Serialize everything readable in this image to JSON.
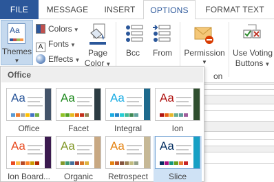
{
  "tabs": [
    {
      "label": "FILE"
    },
    {
      "label": "MESSAGE"
    },
    {
      "label": "INSERT"
    },
    {
      "label": "OPTIONS"
    },
    {
      "label": "FORMAT TEXT"
    }
  ],
  "active_tab": "OPTIONS",
  "ribbon": {
    "themes_label": "Themes",
    "colors_label": "Colors",
    "fonts_label": "Fonts",
    "effects_label": "Effects",
    "page_color_label_1": "Page",
    "page_color_label_2": "Color",
    "bcc_label": "Bcc",
    "from_label": "From",
    "permission_label": "Permission",
    "voting_label_1": "Use Voting",
    "voting_label_2": "Buttons",
    "partial_group_label": "on"
  },
  "themes_menu": {
    "section_header": "Office",
    "selected": "Slice",
    "themes": [
      {
        "name": "Office",
        "accent": "#2b579a",
        "swatches": [
          "#5b9bd5",
          "#ed7d31",
          "#a5a5a5",
          "#ffc000",
          "#4472c4",
          "#70ad47"
        ],
        "sidebar": "#44546a"
      },
      {
        "name": "Facet",
        "accent": "#218b21",
        "swatches": [
          "#90c226",
          "#54a021",
          "#e6b91e",
          "#e76618",
          "#c42f1a",
          "#918655"
        ],
        "sidebar": "#2c3c43"
      },
      {
        "name": "Integral",
        "accent": "#1cade4",
        "swatches": [
          "#1cade4",
          "#2683c6",
          "#27ced7",
          "#42ba97",
          "#3e8853",
          "#62a39f"
        ],
        "sidebar": "#1e6a8d"
      },
      {
        "name": "Ion",
        "accent": "#b01513",
        "swatches": [
          "#b01513",
          "#ea6312",
          "#e6b729",
          "#6aac90",
          "#5f9c9d",
          "#9e5e9b"
        ],
        "sidebar": "#2f4f2f"
      },
      {
        "name": "Ion Board...",
        "accent": "#e84c22",
        "swatches": [
          "#e84c22",
          "#ffbd47",
          "#b64926",
          "#ff8427",
          "#cc9900",
          "#b22600"
        ],
        "sidebar": "#3b1a4f"
      },
      {
        "name": "Organic",
        "accent": "#83992a",
        "swatches": [
          "#83992a",
          "#3c9770",
          "#44709d",
          "#a23c33",
          "#d97828",
          "#deb340"
        ],
        "sidebar": "#c8a882"
      },
      {
        "name": "Retrospect",
        "accent": "#e48312",
        "swatches": [
          "#e48312",
          "#bd582c",
          "#865640",
          "#9b8357",
          "#c2bc80",
          "#94a088"
        ],
        "sidebar": "#c6b896"
      },
      {
        "name": "Slice",
        "accent": "#052f61",
        "swatches": [
          "#052f61",
          "#a50e82",
          "#14967c",
          "#6a9e1f",
          "#e87d37",
          "#c62324"
        ],
        "sidebar": "#17a0c4"
      }
    ]
  }
}
